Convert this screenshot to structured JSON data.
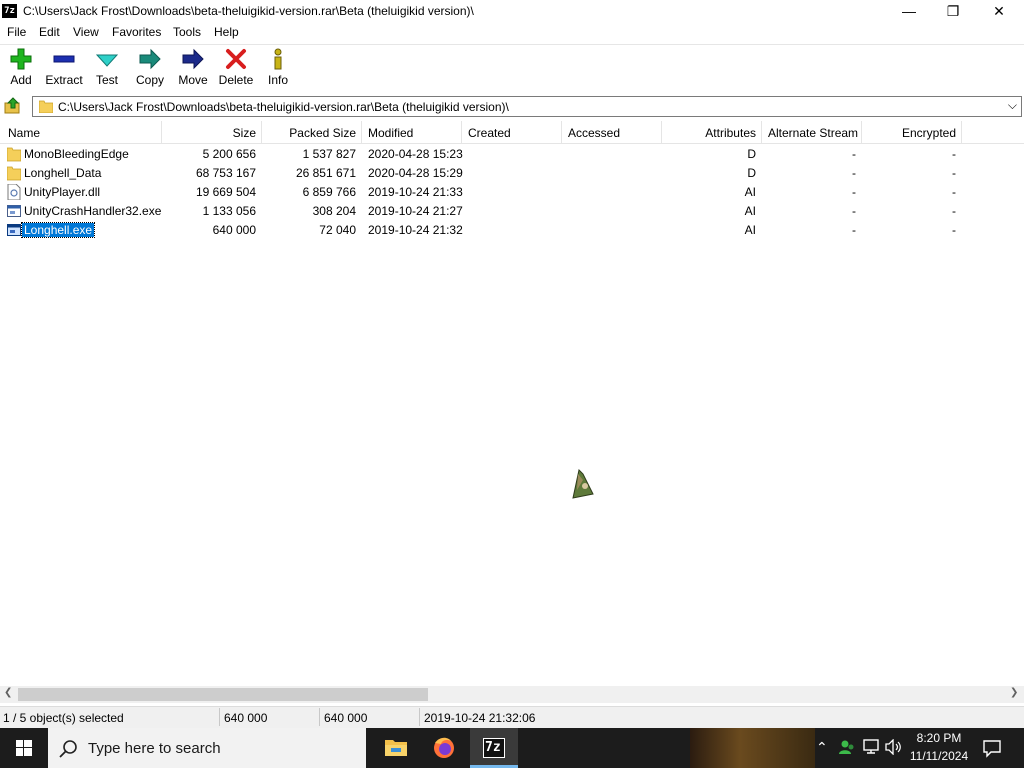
{
  "window": {
    "app_icon_text": "7z",
    "title": "C:\\Users\\Jack Frost\\Downloads\\beta-theluigikid-version.rar\\Beta (theluigikid version)\\",
    "controls": {
      "minimize": "—",
      "restore": "❐",
      "close": "✕"
    }
  },
  "menu": [
    "File",
    "Edit",
    "View",
    "Favorites",
    "Tools",
    "Help"
  ],
  "toolbar": {
    "add": "Add",
    "extract": "Extract",
    "test": "Test",
    "copy": "Copy",
    "move": "Move",
    "delete": "Delete",
    "info": "Info"
  },
  "address": {
    "path": "C:\\Users\\Jack Frost\\Downloads\\beta-theluigikid-version.rar\\Beta (theluigikid version)\\",
    "chevron": "⌵"
  },
  "columns": {
    "name": "Name",
    "size": "Size",
    "packed": "Packed Size",
    "modified": "Modified",
    "created": "Created",
    "accessed": "Accessed",
    "attributes": "Attributes",
    "alt_stream": "Alternate Stream",
    "encrypted": "Encrypted"
  },
  "files": [
    {
      "name": "MonoBleedingEdge",
      "icon": "folder-icon",
      "size": "5 200 656",
      "packed": "1 537 827",
      "modified": "2020-04-28 15:23",
      "attributes": "D",
      "alt_stream": "-",
      "encrypted": "-"
    },
    {
      "name": "Longhell_Data",
      "icon": "folder-icon",
      "size": "68 753 167",
      "packed": "26 851 671",
      "modified": "2020-04-28 15:29",
      "attributes": "D",
      "alt_stream": "-",
      "encrypted": "-"
    },
    {
      "name": "UnityPlayer.dll",
      "icon": "dll-file-icon",
      "size": "19 669 504",
      "packed": "6 859 766",
      "modified": "2019-10-24 21:33",
      "attributes": "AI",
      "alt_stream": "-",
      "encrypted": "-"
    },
    {
      "name": "UnityCrashHandler32.exe",
      "icon": "exe-file-icon",
      "size": "1 133 056",
      "packed": "308 204",
      "modified": "2019-10-24 21:27",
      "attributes": "AI",
      "alt_stream": "-",
      "encrypted": "-"
    },
    {
      "name": "Longhell.exe",
      "icon": "exe-file-icon",
      "size": "640 000",
      "packed": "72 040",
      "modified": "2019-10-24 21:32",
      "attributes": "AI",
      "alt_stream": "-",
      "encrypted": "-",
      "selected": true
    }
  ],
  "scroll": {
    "left_arrow": "❮",
    "right_arrow": "❯"
  },
  "status": {
    "selection": "1 / 5 object(s) selected",
    "size": "640 000",
    "packed": "640 000",
    "modified": "2019-10-24 21:32:06"
  },
  "taskbar": {
    "search_placeholder": "Type here to search",
    "time": "8:20 PM",
    "date": "11/11/2024",
    "apps": [
      "file-explorer-icon",
      "firefox-icon",
      "7zip-icon"
    ],
    "seven_zip_label": "7z"
  },
  "colors": {
    "selection": "#0078d7",
    "taskbar": "#1c1c1c",
    "active_app_underline": "#76b9ed"
  }
}
